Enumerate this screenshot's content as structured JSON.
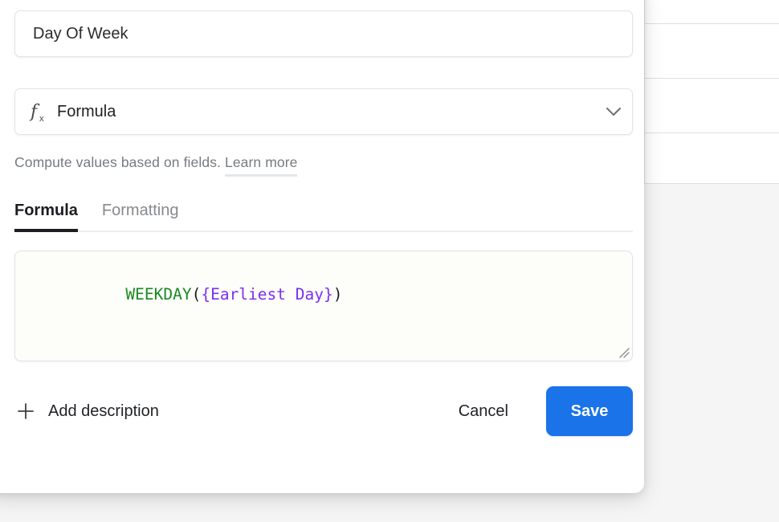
{
  "panel": {
    "field_name": {
      "value": "Day Of Week",
      "placeholder": "Field name (optional)"
    },
    "field_type": {
      "label": "Formula",
      "icon": "fx-icon",
      "chevron_icon": "chevron-down-icon"
    },
    "help": {
      "text": "Compute values based on fields.",
      "link_label": "Learn more"
    },
    "tabs": [
      {
        "label": "Formula",
        "active": true
      },
      {
        "label": "Formatting",
        "active": false
      }
    ],
    "formula": {
      "tokens": [
        {
          "text": "WEEKDAY",
          "type": "fn"
        },
        {
          "text": "(",
          "type": "paren"
        },
        {
          "text": "{Earliest Day}",
          "type": "field"
        },
        {
          "text": ")",
          "type": "paren"
        }
      ],
      "full_text": "WEEKDAY({Earliest Day})",
      "resize_handle_icon": "resize-grip-icon"
    },
    "footer": {
      "add_description_label": "Add description",
      "add_description_icon": "plus-icon",
      "cancel_label": "Cancel",
      "save_label": "Save"
    }
  },
  "colors": {
    "accent_blue": "#1a73e8",
    "formula_function": "#1a8a23",
    "formula_field": "#7b2ff2",
    "muted_text": "#767b80",
    "panel_bg": "#ffffff",
    "page_bg": "#f5f5f5",
    "grid_line": "#dcdfe3"
  }
}
